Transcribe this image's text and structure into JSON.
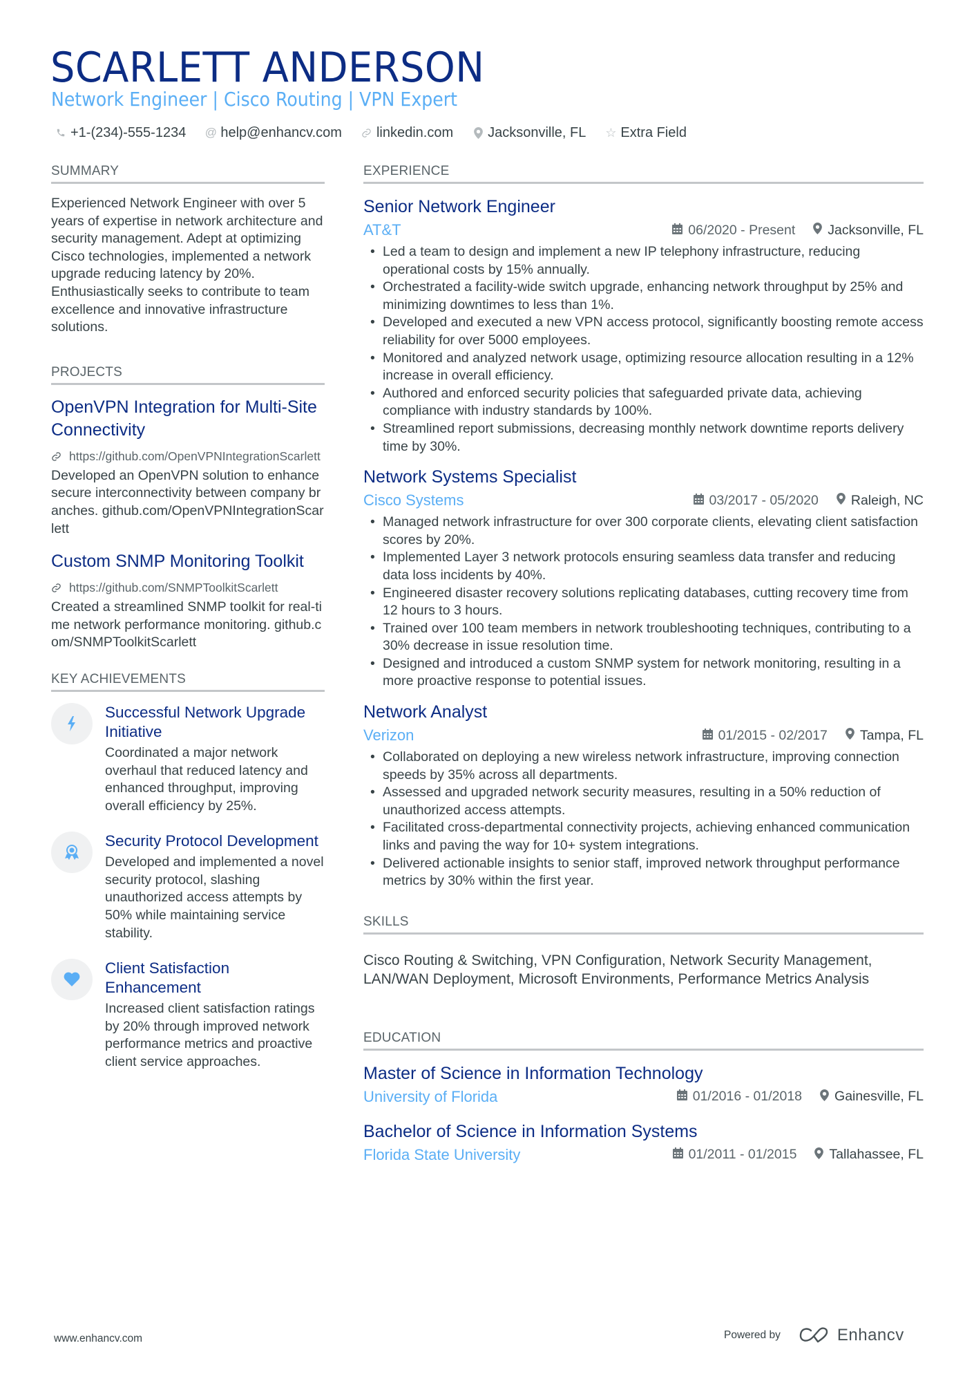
{
  "header": {
    "name": "SCARLETT ANDERSON",
    "headline": "Network Engineer | Cisco Routing | VPN Expert",
    "contacts": [
      {
        "icon": "phone-icon",
        "text": "+1-(234)-555-1234"
      },
      {
        "icon": "at-icon",
        "text": "help@enhancv.com"
      },
      {
        "icon": "link-icon",
        "text": "linkedin.com"
      },
      {
        "icon": "location-icon",
        "text": "Jacksonville, FL"
      },
      {
        "icon": "star-icon",
        "text": "Extra Field"
      }
    ]
  },
  "colors": {
    "name": "#0c2c84",
    "accent": "#5aaef5",
    "text": "#384347",
    "rule": "#c3c6c9"
  },
  "summary": {
    "title": "SUMMARY",
    "text": "Experienced Network Engineer with over 5 years of expertise in network architecture and security management. Adept at optimizing Cisco technologies, implemented a network upgrade reducing latency by 20%. Enthusiastically seeks to contribute to team excellence and innovative infrastructure solutions."
  },
  "projects": {
    "title": "PROJECTS",
    "items": [
      {
        "title": "OpenVPN Integration for Multi-Site Connectivity",
        "link": "https://github.com/OpenVPNIntegrationScarlett",
        "description": "Developed an OpenVPN solution to enhance secure interconnectivity between company branches. github.com/OpenVPNIntegrationScarlett"
      },
      {
        "title": "Custom SNMP Monitoring Toolkit",
        "link": "https://github.com/SNMPToolkitScarlett",
        "description": "Created a streamlined SNMP toolkit for real-time network performance monitoring. github.com/SNMPToolkitScarlett"
      }
    ]
  },
  "achievements": {
    "title": "KEY ACHIEVEMENTS",
    "items": [
      {
        "icon": "lightning-icon",
        "title": "Successful Network Upgrade Initiative",
        "description": "Coordinated a major network overhaul that reduced latency and enhanced throughput, improving overall efficiency by 25%."
      },
      {
        "icon": "award-ribbon-icon",
        "title": "Security Protocol Development",
        "description": "Developed and implemented a novel security protocol, slashing unauthorized access attempts by 50% while maintaining service stability."
      },
      {
        "icon": "heart-icon",
        "title": "Client Satisfaction Enhancement",
        "description": "Increased client satisfaction ratings by 20% through improved network performance metrics and proactive client service approaches."
      }
    ]
  },
  "experience": {
    "title": "EXPERIENCE",
    "jobs": [
      {
        "title": "Senior Network Engineer",
        "company": "AT&T",
        "dates": "06/2020 - Present",
        "location": "Jacksonville, FL",
        "bullets": [
          "Led a team to design and implement a new IP telephony infrastructure, reducing operational costs by 15% annually.",
          "Orchestrated a facility-wide switch upgrade, enhancing network throughput by 25% and minimizing downtimes to less than 1%.",
          "Developed and executed a new VPN access protocol, significantly boosting remote access reliability for over 5000 employees.",
          "Monitored and analyzed network usage, optimizing resource allocation resulting in a 12% increase in overall efficiency.",
          "Authored and enforced security policies that safeguarded private data, achieving compliance with industry standards by 100%.",
          "Streamlined report submissions, decreasing monthly network downtime reports delivery time by 30%."
        ]
      },
      {
        "title": "Network Systems Specialist",
        "company": "Cisco Systems",
        "dates": "03/2017 - 05/2020",
        "location": "Raleigh, NC",
        "bullets": [
          "Managed network infrastructure for over 300 corporate clients, elevating client satisfaction scores by 20%.",
          "Implemented Layer 3 network protocols ensuring seamless data transfer and reducing data loss incidents by 40%.",
          "Engineered disaster recovery solutions replicating databases, cutting recovery time from 12 hours to 3 hours.",
          "Trained over 100 team members in network troubleshooting techniques, contributing to a 30% decrease in issue resolution time.",
          "Designed and introduced a custom SNMP system for network monitoring, resulting in a more proactive response to potential issues."
        ]
      },
      {
        "title": "Network Analyst",
        "company": "Verizon",
        "dates": "01/2015 - 02/2017",
        "location": "Tampa, FL",
        "bullets": [
          "Collaborated on deploying a new wireless network infrastructure, improving connection speeds by 35% across all departments.",
          "Assessed and upgraded network security measures, resulting in a 50% reduction of unauthorized access attempts.",
          "Facilitated cross-departmental connectivity projects, achieving enhanced communication links and paving the way for 10+ system integrations.",
          "Delivered actionable insights to senior staff, improved network throughput performance metrics by 30% within the first year."
        ]
      }
    ]
  },
  "skills": {
    "title": "SKILLS",
    "text": "Cisco Routing & Switching, VPN Configuration, Network Security Management, LAN/WAN Deployment, Microsoft Environments, Performance Metrics Analysis"
  },
  "education": {
    "title": "EDUCATION",
    "items": [
      {
        "degree": "Master of Science in Information Technology",
        "school": "University of Florida",
        "dates": "01/2016 - 01/2018",
        "location": "Gainesville, FL"
      },
      {
        "degree": "Bachelor of Science in Information Systems",
        "school": "Florida State University",
        "dates": "01/2011 - 01/2015",
        "location": "Tallahassee, FL"
      }
    ]
  },
  "footer": {
    "website": "www.enhancv.com",
    "powered_by": "Powered by",
    "brand": "Enhancv"
  }
}
